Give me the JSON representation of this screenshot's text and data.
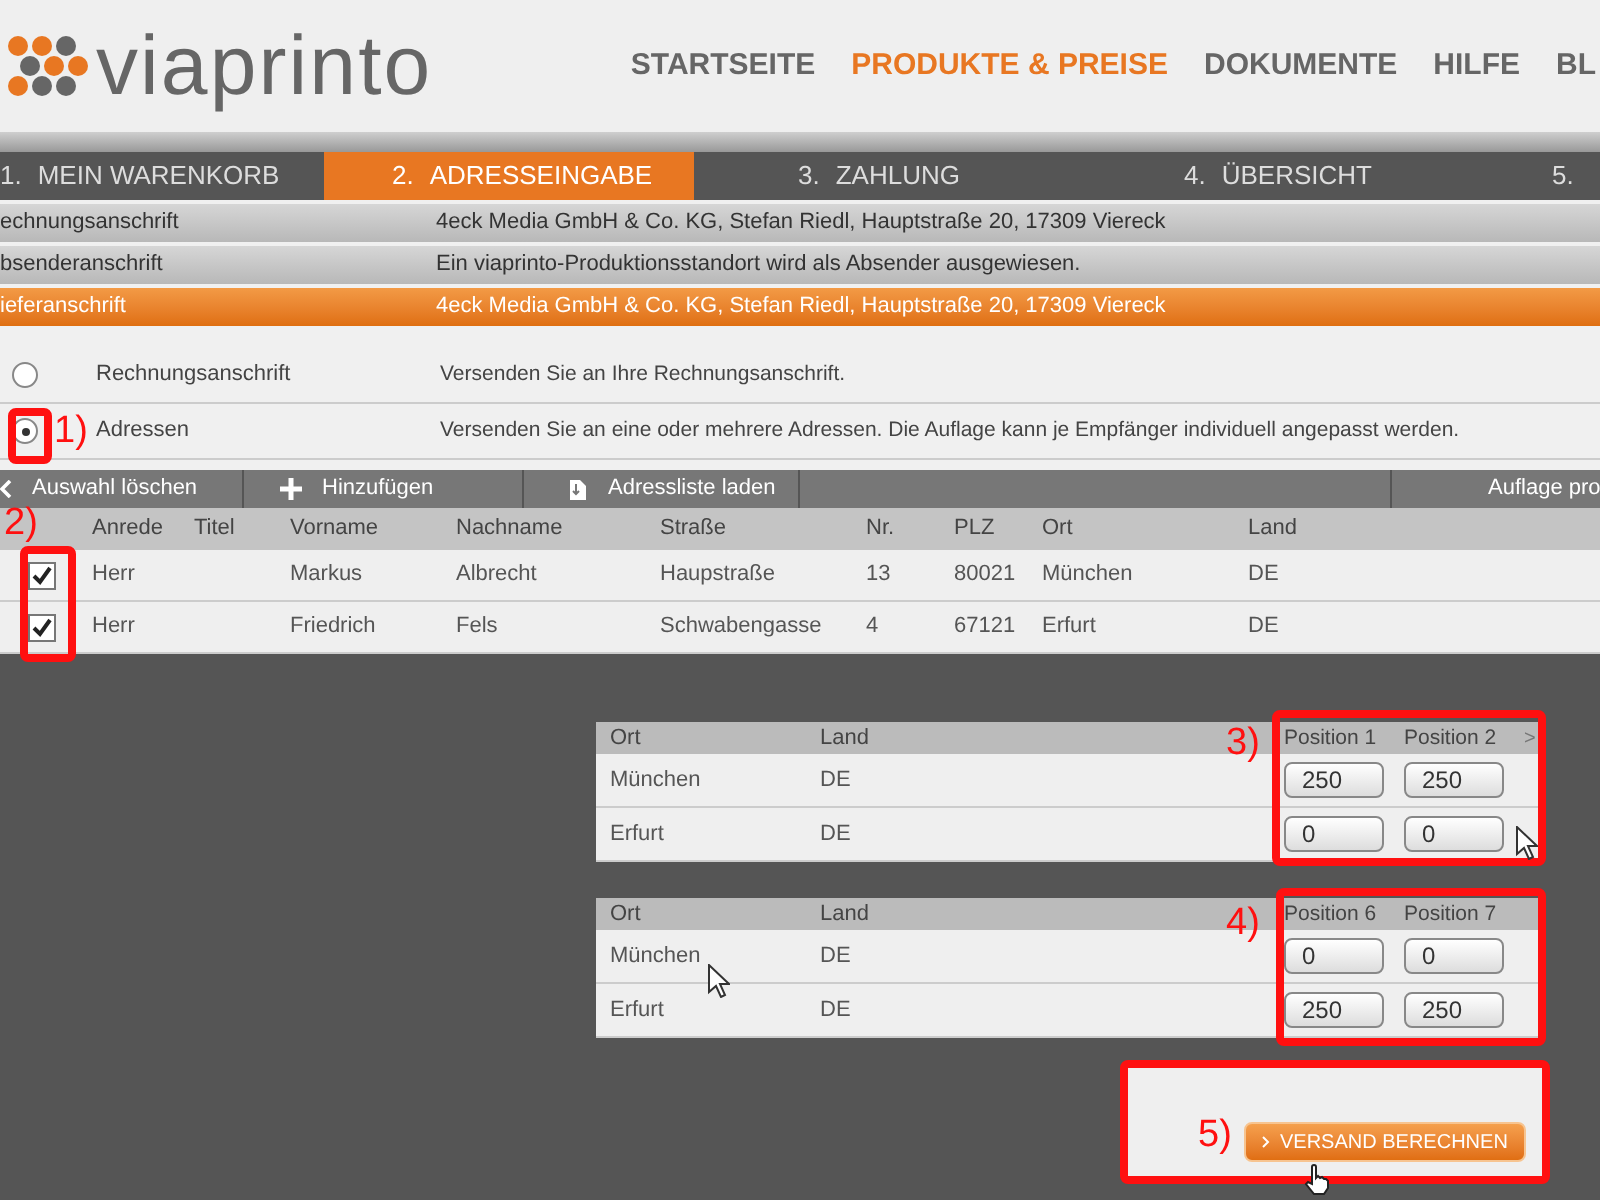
{
  "header": {
    "logo": "viaprinto",
    "nav": [
      {
        "label": "STARTSEITE",
        "selected": false
      },
      {
        "label": "PRODUKTE & PREISE",
        "selected": true
      },
      {
        "label": "DOKUMENTE",
        "selected": false
      },
      {
        "label": "HILFE",
        "selected": false
      },
      {
        "label": "BL",
        "selected": false
      }
    ]
  },
  "steps": [
    {
      "number": "1.",
      "label": "MEIN WARENKORB",
      "selected": false
    },
    {
      "number": "2.",
      "label": "ADRESSEINGABE",
      "selected": true
    },
    {
      "number": "3.",
      "label": "ZAHLUNG",
      "selected": false
    },
    {
      "number": "4.",
      "label": "ÜBERSICHT",
      "selected": false
    },
    {
      "number": "5.",
      "selected": false
    }
  ],
  "address_rows": [
    {
      "label": "echnungsanschrift",
      "value": "4eck Media GmbH & Co. KG, Stefan Riedl, Hauptstraße 20, 17309 Viereck",
      "selected": false
    },
    {
      "label": "bsenderanschrift",
      "value": "Ein viaprinto-Produktionsstandort wird als Absender ausgewiesen.",
      "selected": false
    },
    {
      "label": "ieferanschrift",
      "value": "4eck Media GmbH & Co. KG, Stefan Riedl, Hauptstraße 20, 17309 Viereck",
      "selected": true
    }
  ],
  "shipping_options": [
    {
      "label": "Rechnungsanschrift",
      "description": "Versenden Sie an Ihre Rechnungsanschrift.",
      "selected": false
    },
    {
      "label": "Adressen",
      "description": "Versenden Sie an eine oder mehrere Adressen. Die Auflage kann je Empfänger individuell angepasst werden.",
      "selected": true
    }
  ],
  "toolbar": [
    {
      "kind": "back",
      "label": "Auswahl löschen"
    },
    {
      "kind": "add",
      "label": "Hinzufügen"
    },
    {
      "kind": "load",
      "label": "Adressliste laden"
    },
    {
      "kind": "plain",
      "label": "Auflage pro"
    }
  ],
  "recipients": {
    "columns": [
      "Anrede",
      "Titel",
      "Vorname",
      "Nachname",
      "Straße",
      "Nr.",
      "PLZ",
      "Ort",
      "Land"
    ],
    "rows": [
      {
        "checked": true,
        "anrede": "Herr",
        "vorname": "Markus",
        "nachname": "Albrecht",
        "strasse": "Haupstraße",
        "nr": "13",
        "plz": "80021",
        "ort": "München",
        "land": "DE"
      },
      {
        "checked": true,
        "anrede": "Herr",
        "vorname": "Friedrich",
        "nachname": "Fels",
        "strasse": "Schwabengasse",
        "nr": "4",
        "plz": "67121",
        "ort": "Erfurt",
        "land": "DE"
      }
    ]
  },
  "quantity_panels": [
    {
      "columns": [
        "Ort",
        "Land"
      ],
      "positions": [
        "Position 1",
        "Position 2"
      ],
      "more": ">",
      "rows": [
        {
          "ort": "München",
          "land": "DE",
          "quantities": [
            "250",
            "250"
          ]
        },
        {
          "ort": "Erfurt",
          "land": "DE",
          "quantities": [
            "0",
            "0"
          ]
        }
      ]
    },
    {
      "columns": [
        "Ort",
        "Land"
      ],
      "positions": [
        "Position 6",
        "Position 7"
      ],
      "rows": [
        {
          "ort": "München",
          "land": "DE",
          "quantities": [
            "0",
            "0"
          ]
        },
        {
          "ort": "Erfurt",
          "land": "DE",
          "quantities": [
            "250",
            "250"
          ]
        }
      ]
    }
  ],
  "calculate_button": "VERSAND BERECHNEN",
  "annotations": [
    "1)",
    "2)",
    "3)",
    "4)",
    "5)"
  ]
}
